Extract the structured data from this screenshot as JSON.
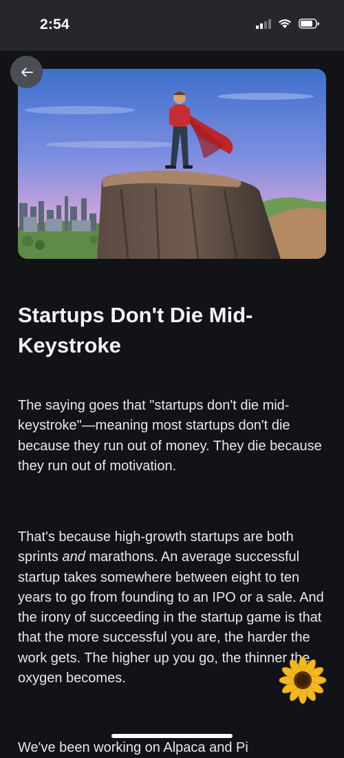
{
  "status_bar": {
    "time": "2:54",
    "icons": [
      "cellular-signal-icon",
      "wifi-icon",
      "battery-icon"
    ]
  },
  "hero": {
    "image": "superhero-on-cliff-illustration",
    "colors": {
      "sky_top": "#4a7fd6",
      "sky_bottom": "#c9a0d8",
      "cape": "#c0252a"
    }
  },
  "nav": {
    "back_icon": "arrow-left-icon"
  },
  "article": {
    "title": "Startups Don't Die Mid-Keystroke",
    "paragraph1": "The saying goes that \"startups don't die mid-keystroke\"—meaning most startups don't die because they run out of money. They die because they run out of motivation.",
    "paragraph2": {
      "before": "That's because high-growth startups are both sprints ",
      "emphasis": "and",
      "after": " marathons. An average successful startup takes somewhere between eight to ten years to go from founding to an IPO or a sale. And the irony of succeeding in the startup game is that that the more successful you are, the harder the work gets. The higher up you go, the thinner the oxygen becomes."
    },
    "paragraph3_partial": "We've been working on Alpaca and Pi"
  },
  "overlay": {
    "sticker": "sunflower-icon"
  }
}
